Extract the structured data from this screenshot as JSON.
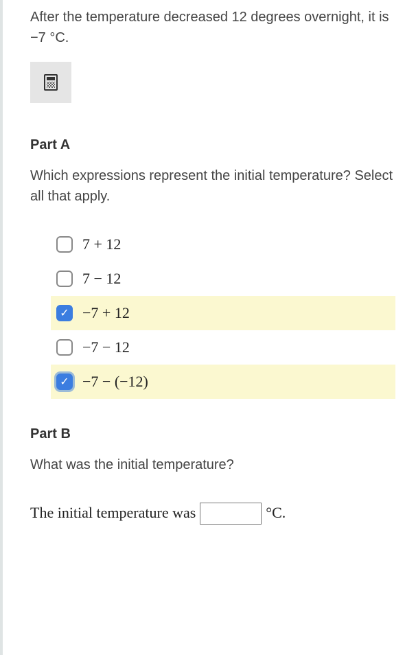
{
  "intro_text": "After the temperature decreased 12 degrees overnight, it is −7 °C.",
  "calculator_icon_name": "calculator-icon",
  "partA": {
    "label": "Part A",
    "question": "Which expressions represent the initial temperature? Select all that apply.",
    "options": [
      {
        "expr": "7 + 12",
        "checked": false,
        "focused": false
      },
      {
        "expr": "7 − 12",
        "checked": false,
        "focused": false
      },
      {
        "expr": "−7 + 12",
        "checked": true,
        "focused": false
      },
      {
        "expr": "−7 − 12",
        "checked": false,
        "focused": false
      },
      {
        "expr": "−7 − (−12)",
        "checked": true,
        "focused": true
      }
    ]
  },
  "partB": {
    "label": "Part B",
    "question": "What was the initial temperature?",
    "answer_prefix": "The initial temperature was",
    "answer_value": "",
    "answer_suffix": "°C."
  }
}
